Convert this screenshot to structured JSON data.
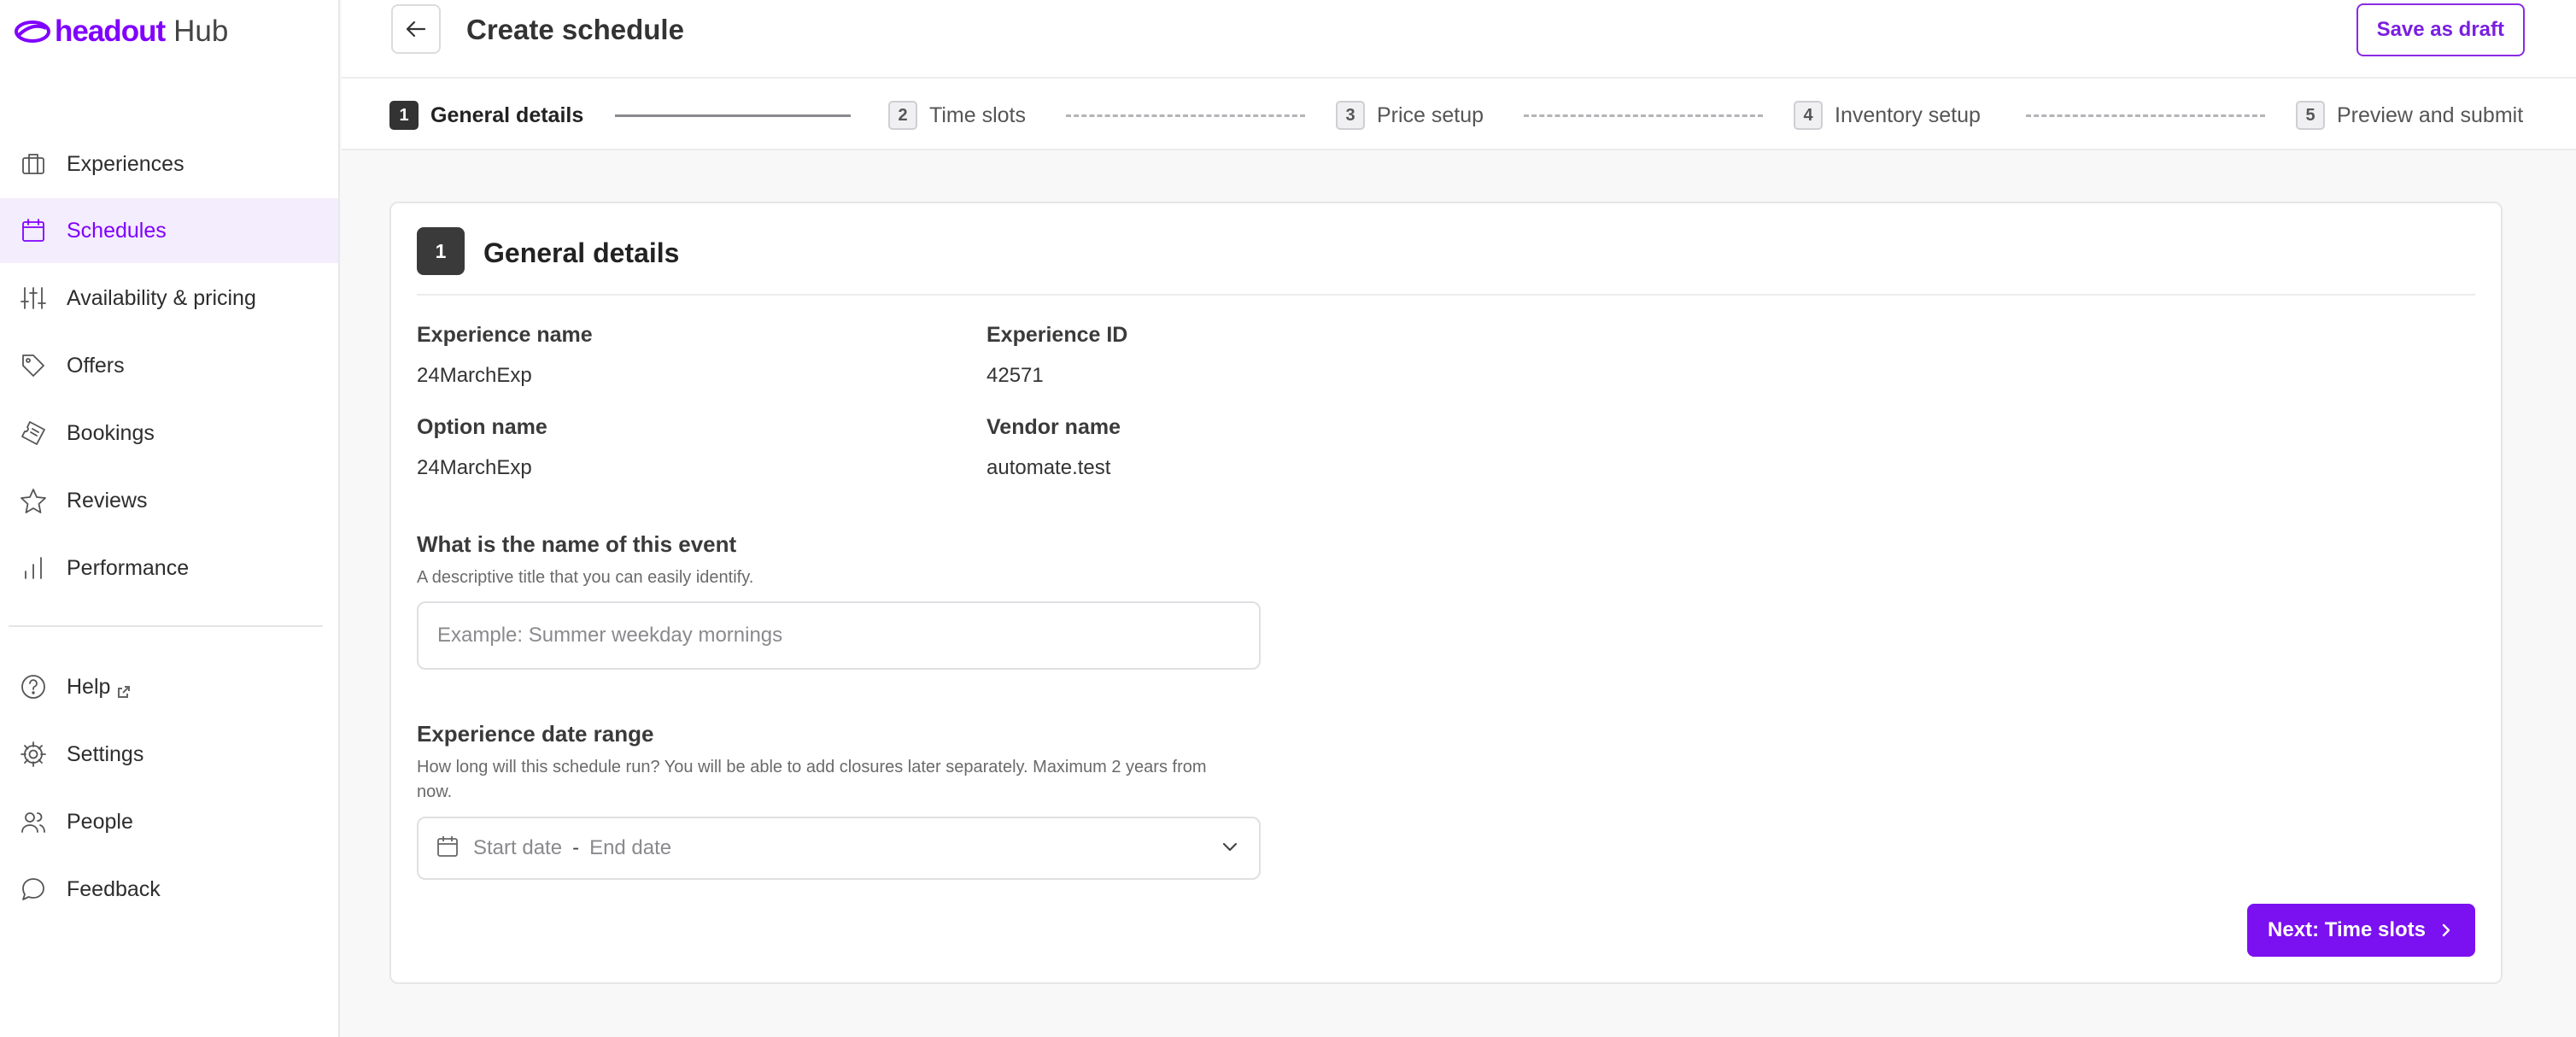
{
  "app": {
    "brand": "headout",
    "product": "Hub",
    "brand_color": "#8000ff"
  },
  "sidebar": {
    "items": [
      {
        "label": "Experiences",
        "icon": "briefcase-icon",
        "active": false
      },
      {
        "label": "Schedules",
        "icon": "calendar-icon",
        "active": true
      },
      {
        "label": "Availability & pricing",
        "icon": "sliders-icon",
        "active": false
      },
      {
        "label": "Offers",
        "icon": "tag-icon",
        "active": false
      },
      {
        "label": "Bookings",
        "icon": "ticket-icon",
        "active": false
      },
      {
        "label": "Reviews",
        "icon": "star-icon",
        "active": false
      },
      {
        "label": "Performance",
        "icon": "bar-chart-icon",
        "active": false
      }
    ],
    "secondary": [
      {
        "label": "Help",
        "icon": "help-circle-icon",
        "external": true
      },
      {
        "label": "Settings",
        "icon": "gear-icon"
      },
      {
        "label": "People",
        "icon": "people-icon"
      },
      {
        "label": "Feedback",
        "icon": "chat-bubble-icon"
      }
    ]
  },
  "header": {
    "title": "Create schedule",
    "save_draft_label": "Save as draft"
  },
  "stepper": {
    "steps": [
      {
        "number": "1",
        "label": "General details",
        "active": true
      },
      {
        "number": "2",
        "label": "Time slots",
        "active": false
      },
      {
        "number": "3",
        "label": "Price setup",
        "active": false
      },
      {
        "number": "4",
        "label": "Inventory setup",
        "active": false
      },
      {
        "number": "5",
        "label": "Preview and submit",
        "active": false
      }
    ]
  },
  "card": {
    "step_number": "1",
    "title": "General details",
    "fields": {
      "experience_name": {
        "label": "Experience name",
        "value": "24MarchExp"
      },
      "experience_id": {
        "label": "Experience ID",
        "value": "42571"
      },
      "option_name": {
        "label": "Option name",
        "value": "24MarchExp"
      },
      "vendor_name": {
        "label": "Vendor name",
        "value": "automate.test"
      }
    },
    "event_name": {
      "title": "What is the name of this event",
      "subtitle": "A descriptive title that you can easily identify.",
      "value": "",
      "placeholder": "Example: Summer weekday mornings"
    },
    "date_range": {
      "title": "Experience date range",
      "subtitle": "How long will this schedule run? You will be able to add closures later separately. Maximum 2 years from now.",
      "start_placeholder": "Start date",
      "separator": "-",
      "end_placeholder": "End date"
    },
    "next_label": "Next: Time slots"
  }
}
